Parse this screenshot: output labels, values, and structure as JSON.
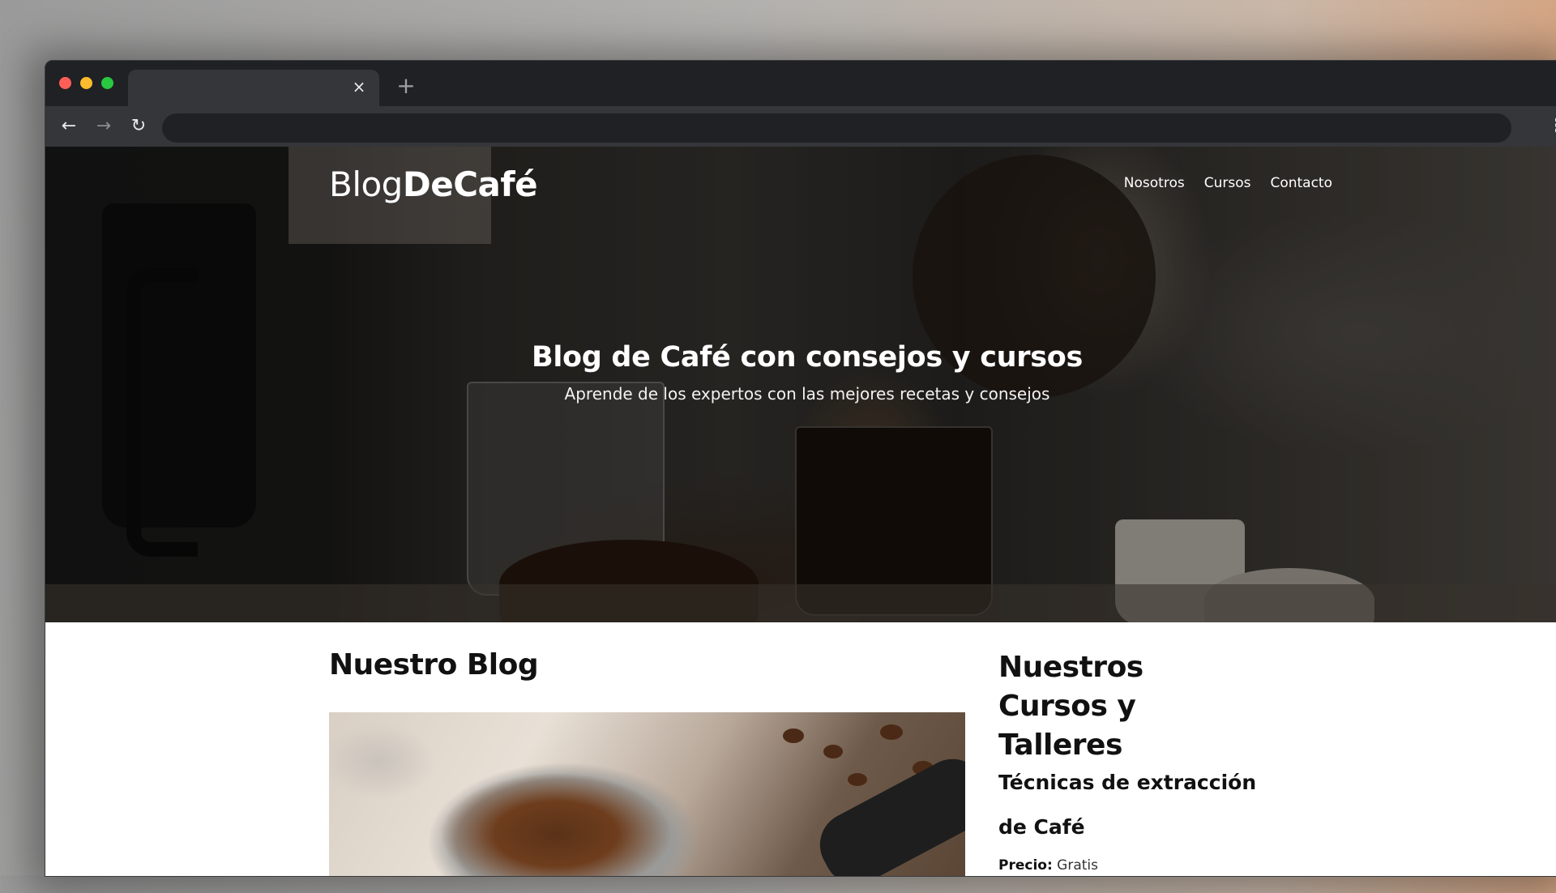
{
  "browser": {
    "tab_title": "",
    "tab_close_icon": "×",
    "new_tab_icon": "+",
    "back_icon": "←",
    "forward_icon": "→",
    "reload_icon": "↻",
    "menu_icon": "⋮",
    "address_value": ""
  },
  "site": {
    "logo_light": "Blog",
    "logo_bold": "DeCafé",
    "nav": [
      "Nosotros",
      "Cursos",
      "Contacto"
    ],
    "hero_title": "Blog de Café con consejos y cursos",
    "hero_subtitle": "Aprende de los expertos con las mejores recetas y consejos"
  },
  "blog": {
    "title": "Nuestro Blog"
  },
  "courses": {
    "title": "Nuestros Cursos y Talleres",
    "first": {
      "name": "Técnicas de extracción de Café",
      "price_label": "Precio:",
      "price_value": "Gratis"
    }
  },
  "colors": {
    "traffic_red": "#ff5f57",
    "traffic_yellow": "#febc2e",
    "traffic_green": "#28c840",
    "chrome_dark": "#202124",
    "chrome_toolbar": "#35363a"
  }
}
